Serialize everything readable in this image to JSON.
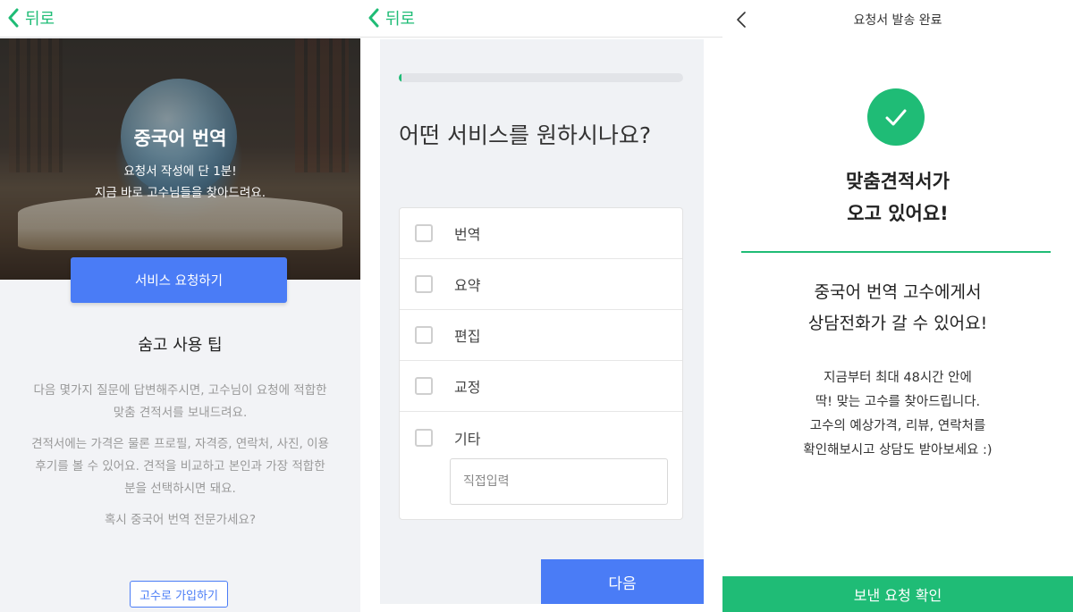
{
  "panel1": {
    "back_label": "뒤로",
    "hero_title": "중국어 번역",
    "hero_subtitle_lines": [
      "요청서 작성에 단 1분!",
      "지금 바로 고수님들을 찾아드려요."
    ],
    "request_button": "서비스 요청하기",
    "tips_title": "숨고 사용 팁",
    "tips_paragraphs": [
      [
        "다음 몇가지 질문에 답변해주시면, 고수님이 요청에 적합한",
        "맞춤 견적서를 보내드려요."
      ],
      [
        "견적서에는 가격은 물론 프로필, 자격증, 연락처, 사진, 이용",
        "후기를 볼 수 있어요. 견적을 비교하고 본인과 가장 적합한",
        "분을 선택하시면 돼요."
      ],
      [
        "혹시 중국어 번역 전문가세요?"
      ]
    ],
    "signup_button": "고수로 가입하기"
  },
  "panel2": {
    "back_label": "뒤로",
    "progress_fraction": 0.01,
    "question": "어떤 서비스를 원하시나요?",
    "options": [
      {
        "label": "번역",
        "checked": false
      },
      {
        "label": "요약",
        "checked": false
      },
      {
        "label": "편집",
        "checked": false
      },
      {
        "label": "교정",
        "checked": false
      },
      {
        "label": "기타",
        "checked": false
      }
    ],
    "direct_input_placeholder": "직접입력",
    "next_button": "다음"
  },
  "panel3": {
    "header_title": "요청서 발송 완료",
    "big_message_lines": [
      "맞춤견적서가",
      "오고 있어요!"
    ],
    "mid_message_lines": [
      "중국어 번역 고수에게서",
      "상담전화가 갈 수 있어요!"
    ],
    "small_message_lines": [
      "지금부터 최대 48시간 안에",
      "딱! 맞는 고수를 찾아드립니다.",
      "고수의 예상가격, 리뷰, 연락처를",
      "확인해보시고 상담도 받아보세요 :)"
    ],
    "confirm_button": "보낸 요청 확인"
  },
  "colors": {
    "brand_green": "#1fbc76",
    "primary_blue": "#4a7cf6"
  }
}
